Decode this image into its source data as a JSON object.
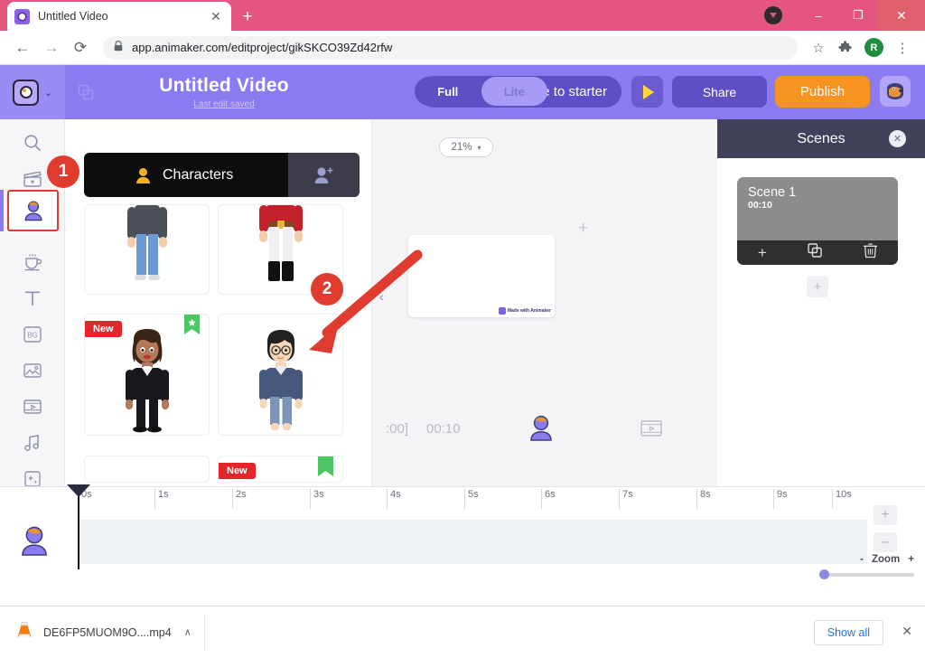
{
  "browser": {
    "tab_title": "Untitled Video",
    "tab_close": "✕",
    "new_tab": "+",
    "nav_back": "←",
    "nav_forward": "→",
    "nav_reload": "⟳",
    "lock_icon": "🔒",
    "url_text": "app.animaker.com/editproject/gikSKCO39Zd42rfw",
    "star_icon": "☆",
    "extensions_icon": "🧩",
    "profile_initial": "R",
    "menu_icon": "⋮",
    "win_minimize": "–",
    "win_maximize": "❐",
    "win_close": "✕"
  },
  "header": {
    "project_title": "Untitled Video",
    "save_status": "Last edit saved",
    "upgrade_label": "e to starter",
    "mode_full": "Full",
    "mode_lite": "Lite",
    "share_label": "Share",
    "publish_label": "Publish",
    "logo_chevron": "⌄"
  },
  "rail": {
    "items": [
      {
        "name": "search-icon",
        "label": "Search"
      },
      {
        "name": "video-library-icon",
        "label": "Video"
      },
      {
        "name": "character-icon",
        "label": "Characters"
      },
      {
        "name": "props-icon",
        "label": "Props"
      },
      {
        "name": "text-icon",
        "label": "T"
      },
      {
        "name": "background-icon",
        "label": "BG"
      },
      {
        "name": "image-icon",
        "label": "Image"
      },
      {
        "name": "film-icon",
        "label": "Video"
      },
      {
        "name": "music-icon",
        "label": "Music"
      },
      {
        "name": "effects-icon",
        "label": "Effects"
      }
    ]
  },
  "library": {
    "panel_title": "Characters",
    "add_character_icon": "add-person-icon",
    "cards": [
      {
        "badge": "",
        "starred": false
      },
      {
        "badge": "",
        "starred": false
      },
      {
        "badge": "New",
        "starred": true
      },
      {
        "badge": "",
        "starred": false
      },
      {
        "badge": "",
        "starred": false
      },
      {
        "badge": "New",
        "starred": true
      }
    ],
    "badge_new": "New"
  },
  "stage": {
    "zoom_level": "21%",
    "zoom_caret": "▾",
    "collapse_icon": "‹",
    "add_icon": "+",
    "watermark": "Made with Animaker",
    "time_left": ":00]",
    "time_right": "00:10"
  },
  "scenes": {
    "title": "Scenes",
    "close": "✕",
    "scene_name": "Scene 1",
    "scene_duration": "00:10",
    "tool_add": "+",
    "tool_duplicate": "duplicate-icon",
    "tool_delete": "trash-icon",
    "add_scene": "+"
  },
  "timeline": {
    "ticks": [
      "0s",
      "1s",
      "2s",
      "3s",
      "4s",
      "5s",
      "6s",
      "7s",
      "8s",
      "9s",
      "10s"
    ],
    "zoom_in": "+",
    "zoom_out": "–",
    "zoom_minus_label": "-",
    "zoom_label": "Zoom",
    "zoom_plus_label": "+"
  },
  "downloads": {
    "file_name": "DE6FP5MUOM9O....mp4",
    "expand_caret": "∧",
    "show_all": "Show all",
    "close": "✕"
  },
  "annotations": {
    "marker_one": "1",
    "marker_two": "2",
    "accent_color": "#e03b2f"
  }
}
